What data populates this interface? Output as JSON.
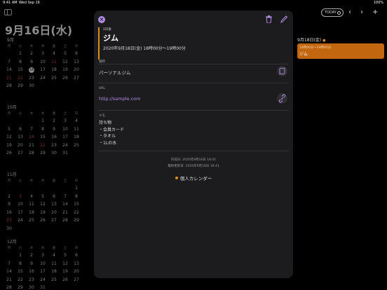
{
  "status_bar": {
    "time": "9:41 AM",
    "date": "Wed Sep 16",
    "battery": "100%"
  },
  "left_panel": {
    "big_date": "9月16日(水)",
    "weekdays": [
      "月",
      "火",
      "水",
      "木",
      "金",
      "土",
      "日"
    ],
    "months": [
      {
        "name": "9月",
        "rows": [
          [
            "",
            "1",
            "2",
            "3",
            "4",
            "5",
            "6"
          ],
          [
            "7",
            "8",
            "9",
            "10",
            "11",
            "12",
            "13"
          ],
          [
            "14",
            "15",
            "16",
            "17",
            "18",
            "19",
            "20"
          ],
          [
            "21",
            "22",
            "23",
            "24",
            "25",
            "26",
            "27"
          ],
          [
            "28",
            "29",
            "30",
            "",
            "",
            "",
            ""
          ]
        ],
        "red": [
          "21",
          "22",
          "11"
        ],
        "today": "16"
      },
      {
        "name": "10月",
        "rows": [
          [
            "",
            "",
            "",
            "1",
            "2",
            "3",
            "4"
          ],
          [
            "5",
            "6",
            "7",
            "8",
            "9",
            "10",
            "11"
          ],
          [
            "12",
            "13",
            "14",
            "15",
            "16",
            "17",
            "18"
          ],
          [
            "19",
            "20",
            "21",
            "22",
            "23",
            "24",
            "25"
          ],
          [
            "26",
            "27",
            "28",
            "29",
            "30",
            "31",
            ""
          ]
        ],
        "red": [
          "14",
          "22"
        ],
        "today": ""
      },
      {
        "name": "11月",
        "rows": [
          [
            "",
            "",
            "",
            "",
            "",
            "",
            "1"
          ],
          [
            "2",
            "3",
            "4",
            "5",
            "6",
            "7",
            "8"
          ],
          [
            "9",
            "10",
            "11",
            "12",
            "13",
            "14",
            "15"
          ],
          [
            "16",
            "17",
            "18",
            "19",
            "20",
            "21",
            "22"
          ],
          [
            "23",
            "24",
            "25",
            "26",
            "27",
            "28",
            "29"
          ],
          [
            "30",
            "",
            "",
            "",
            "",
            "",
            ""
          ]
        ],
        "red": [
          "3",
          "23"
        ],
        "today": ""
      },
      {
        "name": "12月",
        "rows": [
          [
            "",
            "1",
            "2",
            "3",
            "4",
            "5",
            "6"
          ],
          [
            "7",
            "8",
            "9",
            "10",
            "11",
            "12",
            "13"
          ],
          [
            "14",
            "15",
            "16",
            "17",
            "18",
            "19",
            "20"
          ],
          [
            "21",
            "22",
            "23",
            "24",
            "25",
            "26",
            "27"
          ],
          [
            "28",
            "29",
            "30",
            "31",
            "",
            "",
            ""
          ]
        ],
        "red": [],
        "today": ""
      }
    ]
  },
  "right_panel": {
    "today_label": "TODAY",
    "day_header": "9月18日(金)",
    "event_time": "18時00分〜19時00分",
    "event_title": "ジム"
  },
  "popover": {
    "days_left": "2日後",
    "title": "ジム",
    "when": "2020年9月18日(金) 18時00分〜19時00分",
    "location_label": "場所",
    "location": "パーソナルジム",
    "url_label": "URL",
    "url": "http://sample.com",
    "memo_label": "メモ",
    "memo": "持ち物\n・会員カード\n・タオル\n・1Lの水",
    "created": "作成日: 2020年9月16日 18:41",
    "modified": "最終更新日: 2020年9月16日 18:41",
    "calendar": "個人カレンダー"
  },
  "colors": {
    "accent": "#b28ee8",
    "event": "#e08a1e",
    "event_block": "#c2670f"
  },
  "icons": [
    "sidebar-icon",
    "close-icon",
    "trash-icon",
    "pencil-icon",
    "map-icon",
    "link-icon",
    "chevron-left-icon",
    "chevron-right-icon",
    "plus-icon"
  ]
}
